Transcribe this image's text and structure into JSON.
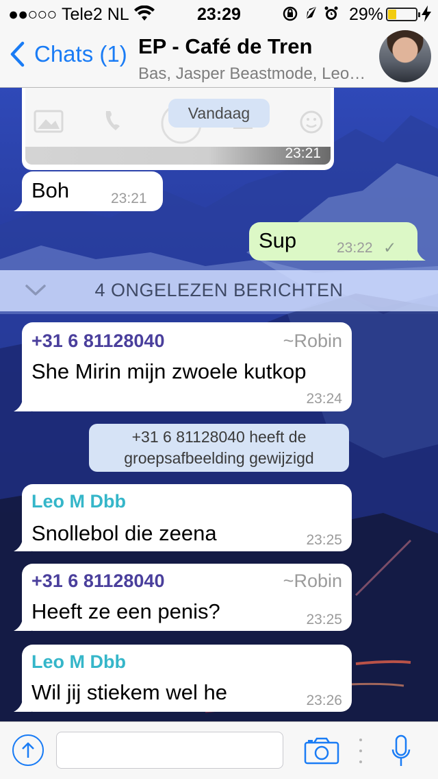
{
  "status_bar": {
    "signal": "●●○○○",
    "carrier": "Tele2 NL",
    "time": "23:29",
    "battery_pct": "29%",
    "battery_level": 0.29,
    "battery_color": "#f2cc0f"
  },
  "nav": {
    "back_label": "Chats (1)",
    "title": "EP - Café de Tren",
    "subtitle": "Bas, Jasper Beastmode, Leo…",
    "accent": "#1a7cf5"
  },
  "messages": {
    "image_time": "23:21",
    "date_label": "Vandaag",
    "boh": {
      "text": "Boh",
      "time": "23:21"
    },
    "sup": {
      "text": "Sup",
      "time": "23:22",
      "status": "✓"
    },
    "unread_banner": "4 ONGELEZEN BERICHTEN",
    "m1": {
      "sender": "+31 6 81128040",
      "handle": "~Robin",
      "text": "She Mirin mijn zwoele kutkop",
      "time": "23:24"
    },
    "system": "+31 6 81128040 heeft de groepsafbeelding gewijzigd",
    "m2": {
      "sender": "Leo M Dbb",
      "text": "Snollebol die zeena",
      "time": "23:25"
    },
    "m3": {
      "sender": "+31 6 81128040",
      "handle": "~Robin",
      "text": "Heeft ze een penis?",
      "time": "23:25"
    },
    "m4": {
      "sender": "Leo M Dbb",
      "text": "Wil jij stiekem wel he",
      "time": "23:26"
    },
    "sender_colors": {
      "robin": "#4a3f9c",
      "leo": "#35b6c9"
    }
  },
  "input": {
    "placeholder": ""
  },
  "icons": {
    "back": "chevron-left-icon",
    "upload": "upload-icon",
    "camera": "camera-icon",
    "mic": "microphone-icon"
  }
}
